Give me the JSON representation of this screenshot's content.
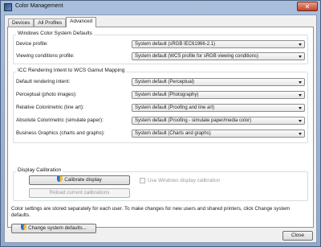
{
  "window": {
    "title": "Color Management",
    "close_glyph": "✕"
  },
  "tabs": [
    {
      "label": "Devices",
      "active": false
    },
    {
      "label": "All Profiles",
      "active": false
    },
    {
      "label": "Advanced",
      "active": true
    }
  ],
  "wcs_defaults": {
    "title": "Windows Color System Defaults",
    "device_profile": {
      "label": "Device profile:",
      "value": "System default (sRGB IEC61966-2.1)"
    },
    "viewing_conditions": {
      "label": "Viewing conditions profile:",
      "value": "System default (WCS profile for sRGB viewing conditions)"
    }
  },
  "rendering_intent": {
    "title": "ICC Rendering Intent to WCS Gamut Mapping",
    "rows": [
      {
        "label": "Default rendering intent:",
        "value": "System default (Perceptual)"
      },
      {
        "label": "Perceptual (photo images):",
        "value": "System default (Photography)"
      },
      {
        "label": "Relative Colorimetric (line art):",
        "value": "System default (Proofing and line art)"
      },
      {
        "label": "Absolute Colorimetric (simulate paper):",
        "value": "System default (Proofing - simulate paper/media color)"
      },
      {
        "label": "Business Graphics (charts and graphs):",
        "value": "System default (Charts and graphs)"
      }
    ]
  },
  "display_calibration": {
    "title": "Display Calibration",
    "calibrate_button": "Calibrate display",
    "reload_button": "Reload current calibrations",
    "use_windows_calibration": "Use Windows display calibration",
    "use_windows_checked": false
  },
  "info_text": "Color settings are stored separately for each user. To make changes for new users and shared printers, click Change system defaults.",
  "change_defaults_button": "Change system defaults...",
  "close_button": "Close",
  "icons": {
    "app": "color-management-icon",
    "shield": "uac-shield-icon",
    "dropdown": "dropdown-arrow-icon"
  }
}
